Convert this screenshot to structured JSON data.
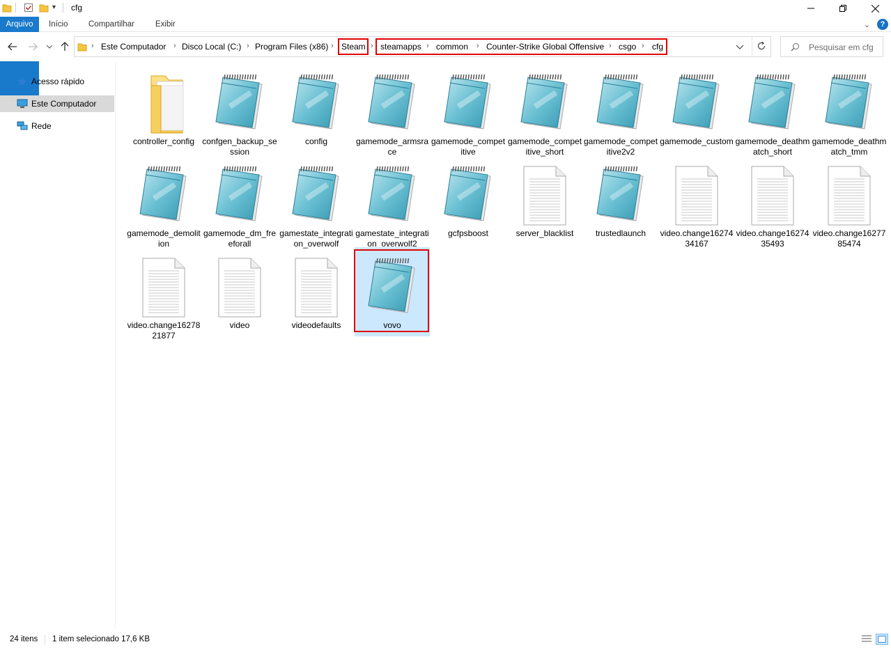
{
  "window": {
    "title": "cfg"
  },
  "ribbon": {
    "tabs": [
      "Arquivo",
      "Início",
      "Compartilhar",
      "Exibir"
    ]
  },
  "address": {
    "crumbs": [
      "Este Computador",
      "Disco Local (C:)",
      "Program Files (x86)",
      "Steam",
      "steamapps",
      "common",
      "Counter-Strike Global Offensive",
      "csgo",
      "cfg"
    ]
  },
  "search": {
    "placeholder": "Pesquisar em cfg"
  },
  "sidebar": {
    "items": [
      {
        "label": "Acesso rápido",
        "icon": "star-icon"
      },
      {
        "label": "Este Computador",
        "icon": "computer-icon"
      },
      {
        "label": "Rede",
        "icon": "network-icon"
      }
    ]
  },
  "files": [
    {
      "name": "controller_config",
      "type": "folder"
    },
    {
      "name": "confgen_backup_session",
      "type": "notepad"
    },
    {
      "name": "config",
      "type": "notepad"
    },
    {
      "name": "gamemode_armsrace",
      "type": "notepad"
    },
    {
      "name": "gamemode_competitive",
      "type": "notepad"
    },
    {
      "name": "gamemode_competitive_short",
      "type": "notepad"
    },
    {
      "name": "gamemode_competitive2v2",
      "type": "notepad"
    },
    {
      "name": "gamemode_custom",
      "type": "notepad"
    },
    {
      "name": "gamemode_deathmatch_short",
      "type": "notepad"
    },
    {
      "name": "gamemode_deathmatch_tmm",
      "type": "notepad"
    },
    {
      "name": "gamemode_demolition",
      "type": "notepad"
    },
    {
      "name": "gamemode_dm_freeforall",
      "type": "notepad"
    },
    {
      "name": "gamestate_integration_overwolf",
      "type": "notepad"
    },
    {
      "name": "gamestate_integration_overwolf2",
      "type": "notepad"
    },
    {
      "name": "gcfpsboost",
      "type": "notepad"
    },
    {
      "name": "server_blacklist",
      "type": "text"
    },
    {
      "name": "trustedlaunch",
      "type": "notepad"
    },
    {
      "name": "video.change1627434167",
      "type": "text"
    },
    {
      "name": "video.change1627435493",
      "type": "text"
    },
    {
      "name": "video.change1627785474",
      "type": "text"
    },
    {
      "name": "video.change1627821877",
      "type": "text"
    },
    {
      "name": "video",
      "type": "text"
    },
    {
      "name": "videodefaults",
      "type": "text"
    },
    {
      "name": "vovo",
      "type": "notepad",
      "selected": true
    }
  ],
  "status": {
    "count": "24 itens",
    "selection": "1 item selecionado  17,6 KB"
  },
  "colors": {
    "accent": "#1979ca",
    "selection": "#cce8ff",
    "highlight_border": "#e00000"
  }
}
